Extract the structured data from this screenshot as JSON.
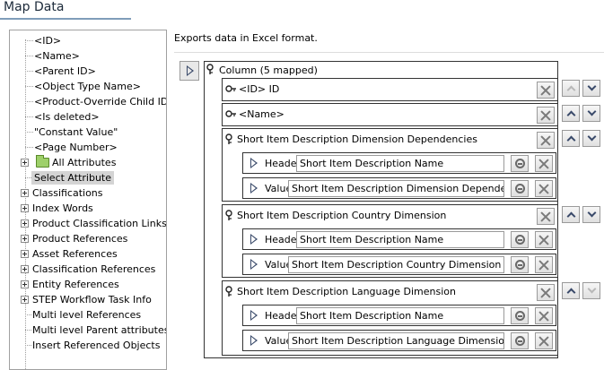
{
  "window": {
    "title": "Map Data"
  },
  "description": "Exports data in Excel format.",
  "tree": {
    "items": [
      {
        "label": "<ID>",
        "type": "leaf"
      },
      {
        "label": "<Name>",
        "type": "leaf"
      },
      {
        "label": "<Parent ID>",
        "type": "leaf"
      },
      {
        "label": "<Object Type Name>",
        "type": "leaf"
      },
      {
        "label": "<Product-Override Child ID>",
        "type": "leaf"
      },
      {
        "label": "<Is deleted>",
        "type": "leaf"
      },
      {
        "label": "\"Constant Value\"",
        "type": "leaf"
      },
      {
        "label": "<Page Number>",
        "type": "leaf"
      },
      {
        "label": "All Attributes",
        "type": "folder"
      },
      {
        "label": "Select Attribute",
        "type": "selected"
      },
      {
        "label": "Classifications",
        "type": "plus"
      },
      {
        "label": "Index Words",
        "type": "plus"
      },
      {
        "label": "Product Classification Links",
        "type": "plus"
      },
      {
        "label": "Product References",
        "type": "plus"
      },
      {
        "label": "Asset References",
        "type": "plus"
      },
      {
        "label": "Classification References",
        "type": "plus"
      },
      {
        "label": "Entity References",
        "type": "plus"
      },
      {
        "label": "STEP Workflow Task Info",
        "type": "plus"
      },
      {
        "label": "Multi level References",
        "type": "leaf"
      },
      {
        "label": "Multi level Parent attributes",
        "type": "leaf"
      },
      {
        "label": "Insert Referenced Objects",
        "type": "leaf"
      }
    ]
  },
  "mapping": {
    "column_label": "Column (5 mapped)",
    "simple_rows": [
      {
        "label": "<ID> ID"
      },
      {
        "label": "<Name>"
      }
    ],
    "groups": [
      {
        "title": "Short Item Description Dimension Dependencies",
        "header_label": "Header",
        "header_value": "Short Item Description Name",
        "value_label": "Value",
        "value_value": "Short Item Description Dimension Dependencies"
      },
      {
        "title": "Short Item Description Country Dimension",
        "header_label": "Header",
        "header_value": "Short Item Description Name",
        "value_label": "Value",
        "value_value": "Short Item Description Country Dimension"
      },
      {
        "title": "Short Item Description Language Dimension",
        "header_label": "Header",
        "header_value": "Short Item Description Name",
        "value_label": "Value",
        "value_value": "Short Item Description Language Dimension"
      }
    ]
  },
  "icons": {
    "key": "key-icon",
    "remove": "close-icon",
    "link": "link-icon",
    "up": "chevron-up-icon",
    "down": "chevron-down-icon",
    "expand": "play-icon",
    "folder": "folder-icon"
  },
  "colors": {
    "folder": "#9ed06a",
    "selected": "#d4d4d4",
    "arrow": "#3a4a6a"
  }
}
